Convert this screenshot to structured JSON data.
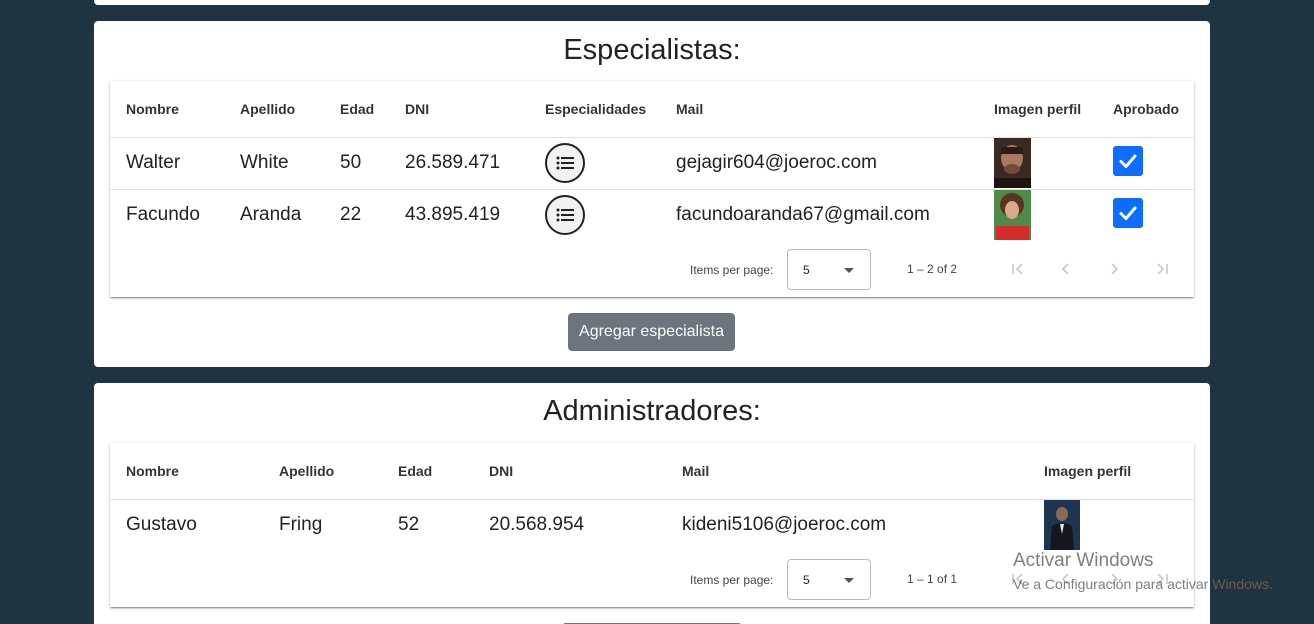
{
  "especialistas": {
    "title": "Especialistas:",
    "columns": [
      "Nombre",
      "Apellido",
      "Edad",
      "DNI",
      "Especialidades",
      "Mail",
      "Imagen perfil",
      "Aprobado"
    ],
    "rows": [
      {
        "nombre": "Walter",
        "apellido": "White",
        "edad": "50",
        "dni": "26.589.471",
        "mail": "gejagir604@joeroc.com",
        "aprobado": true
      },
      {
        "nombre": "Facundo",
        "apellido": "Aranda",
        "edad": "22",
        "dni": "43.895.419",
        "mail": "facundoaranda67@gmail.com",
        "aprobado": true
      }
    ],
    "paginator": {
      "items_label": "Items per page:",
      "page_size": "5",
      "range": "1 – 2 of 2"
    },
    "add_button": "Agregar especialista"
  },
  "administradores": {
    "title": "Administradores:",
    "columns": [
      "Nombre",
      "Apellido",
      "Edad",
      "DNI",
      "Mail",
      "Imagen perfil"
    ],
    "rows": [
      {
        "nombre": "Gustavo",
        "apellido": "Fring",
        "edad": "52",
        "dni": "20.568.954",
        "mail": "kideni5106@joeroc.com"
      }
    ],
    "paginator": {
      "items_label": "Items per page:",
      "page_size": "5",
      "range": "1 – 1 of 1"
    }
  },
  "watermark": {
    "title": "Activar Windows",
    "subtitle": "Ve a Configuración para activar Windows."
  },
  "icons": [
    "list-icon",
    "check-icon",
    "first-page-icon",
    "prev-page-icon",
    "next-page-icon",
    "last-page-icon",
    "dropdown-arrow-icon"
  ],
  "colors": {
    "background": "#1f3441",
    "checkbox": "#0d6efd",
    "button": "#6c757d"
  }
}
